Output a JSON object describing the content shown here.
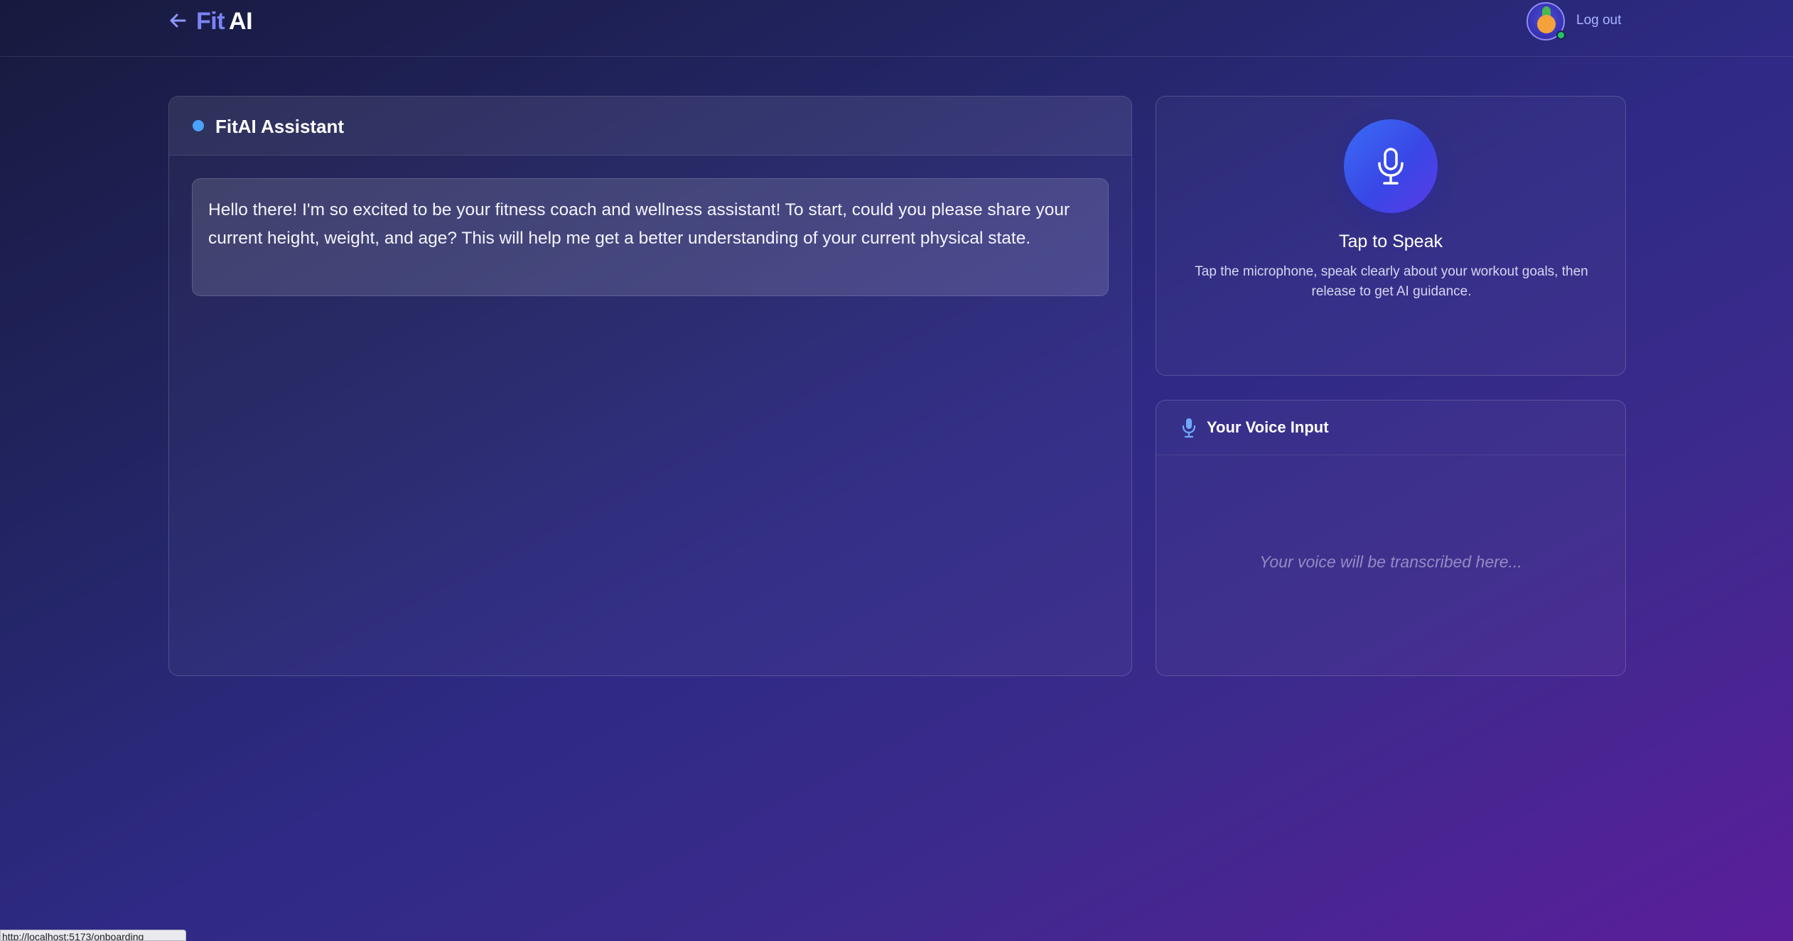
{
  "header": {
    "logo_fit": "Fit",
    "logo_ai": "AI",
    "logout_label": "Log out",
    "back_icon": "arrow-left-icon",
    "avatar_icon": "user-avatar"
  },
  "chat": {
    "title": "FitAI Assistant",
    "messages": [
      {
        "role": "assistant",
        "text": "Hello there! I'm so excited to be your fitness coach and wellness assistant! To start, could you please share your current height, weight, and age? This will help me get a better understanding of your current physical state."
      }
    ]
  },
  "speak": {
    "title": "Tap to Speak",
    "description": "Tap the microphone, speak clearly about your workout goals, then release to get AI guidance.",
    "icon": "microphone-icon"
  },
  "voice_input": {
    "title": "Your Voice Input",
    "placeholder": "Your voice will be transcribed here..."
  },
  "status_bar": {
    "url": "http://localhost:5173/onboarding"
  },
  "colors": {
    "accent": "#7b83f5",
    "mic_button": "#3b6cf6",
    "status_online": "#22c55e",
    "assistant_dot": "#4aa3ff"
  }
}
